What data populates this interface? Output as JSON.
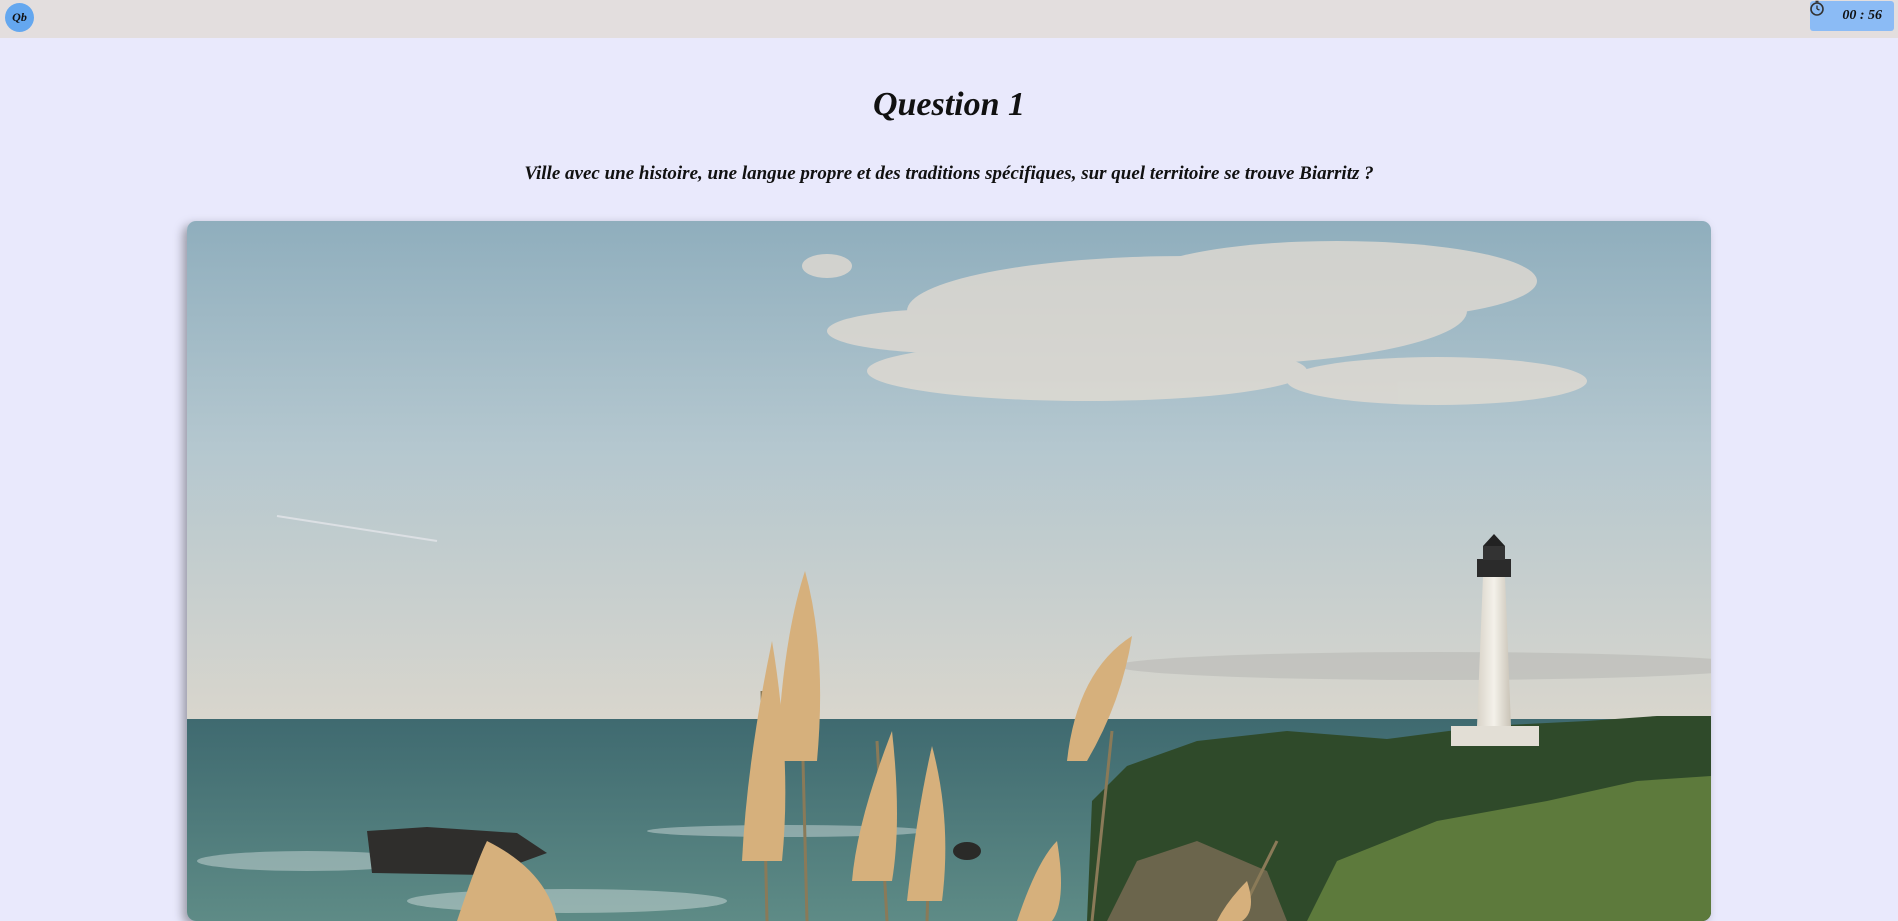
{
  "header": {
    "logo_text": "Qb",
    "timer_text": "00 : 56",
    "timer_icon": "stopwatch-icon"
  },
  "quiz": {
    "title": "Question 1",
    "question_text": "Ville avec une histoire, une langue propre et des traditions spécifiques, sur quel territoire se trouve Biarritz ?"
  },
  "colors": {
    "page_background": "#e9e9fc",
    "topbar": "#e3dede",
    "logo": "#64a7ef",
    "timer": "#8bbbf5"
  }
}
